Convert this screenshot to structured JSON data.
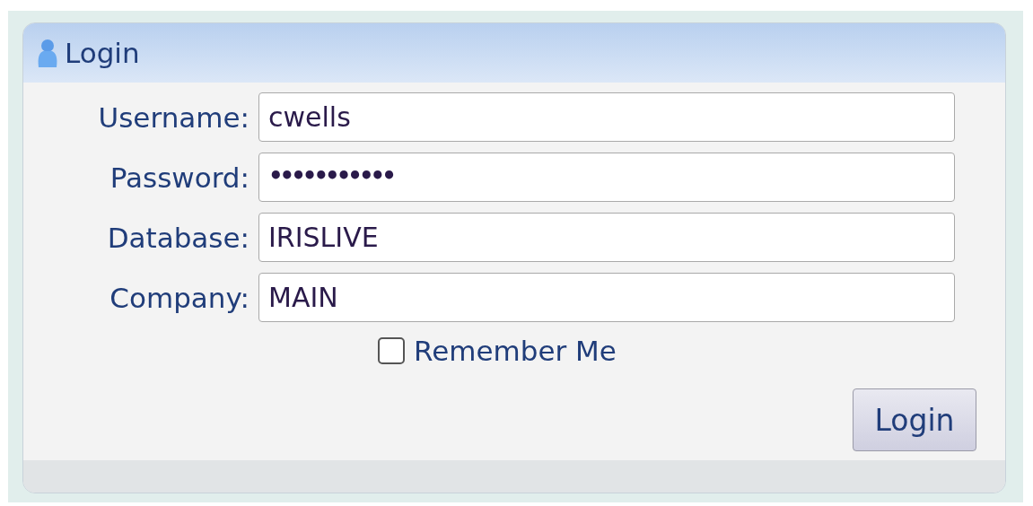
{
  "panel": {
    "title": "Login"
  },
  "fields": [
    {
      "label": "Username:",
      "value": "cwells"
    },
    {
      "label": "Password:",
      "value": "•••••••••••",
      "kind": "password"
    },
    {
      "label": "Database:",
      "value": "IRISLIVE"
    },
    {
      "label": "Company:",
      "value": "MAIN"
    }
  ],
  "remember": {
    "label": "Remember Me",
    "checked": false
  },
  "buttons": [
    "Login"
  ]
}
